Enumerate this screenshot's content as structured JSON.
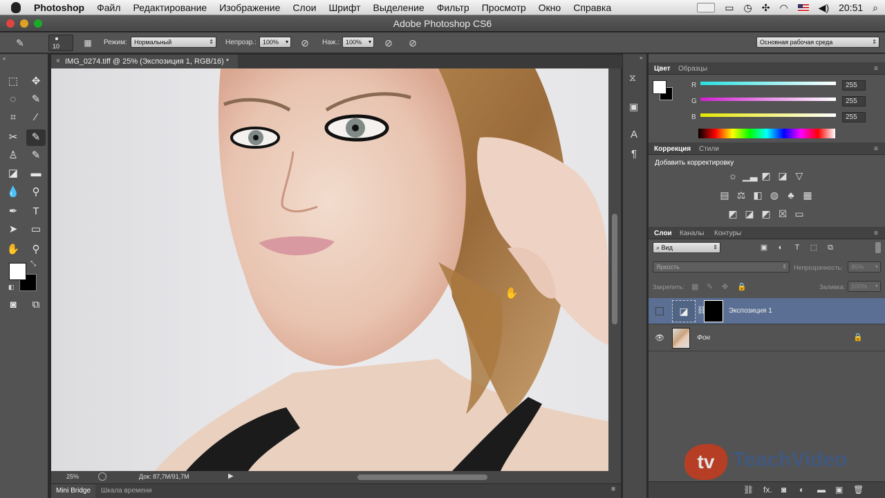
{
  "menubar": {
    "app": "Photoshop",
    "items": [
      "Файл",
      "Редактирование",
      "Изображение",
      "Слои",
      "Шрифт",
      "Выделение",
      "Фильтр",
      "Просмотр",
      "Окно",
      "Справка"
    ],
    "time": "20:51"
  },
  "window": {
    "title": "Adobe Photoshop CS6"
  },
  "options": {
    "brush_size": "10",
    "mode_label": "Режим:",
    "mode_value": "Нормальный",
    "opacity_label": "Непрозр.:",
    "opacity_value": "100%",
    "pressure_label": "Наж.:",
    "pressure_value": "100%",
    "workspace": "Основная рабочая среда"
  },
  "document": {
    "tab": "IMG_0274.tiff @ 25% (Экспозиция 1, RGB/16) *",
    "zoom": "25%",
    "doc_info": "Док: 87,7M/91,7M"
  },
  "bottom_tabs": [
    "Mini Bridge",
    "Шкала времени"
  ],
  "color_panel": {
    "tabs": [
      "Цвет",
      "Образцы"
    ],
    "channels": [
      {
        "name": "R",
        "value": "255",
        "color": "#29e0e0"
      },
      {
        "name": "G",
        "value": "255",
        "color": "#d020d0"
      },
      {
        "name": "B",
        "value": "255",
        "color": "#e6e600"
      }
    ]
  },
  "adjust_panel": {
    "tabs": [
      "Коррекция",
      "Стили"
    ],
    "heading": "Добавить корректировку"
  },
  "layers_panel": {
    "tabs": [
      "Слои",
      "Каналы",
      "Контуры"
    ],
    "filter": "Вид",
    "blend": "Яркость",
    "opacity_label": "Непрозрачность:",
    "opacity_value": "85%",
    "lock_label": "Закрепить:",
    "fill_label": "Заливка:",
    "fill_value": "100%",
    "layers": [
      {
        "name": "Экспозиция 1"
      },
      {
        "name": "Фон"
      }
    ]
  },
  "watermark": "TeachVideo"
}
